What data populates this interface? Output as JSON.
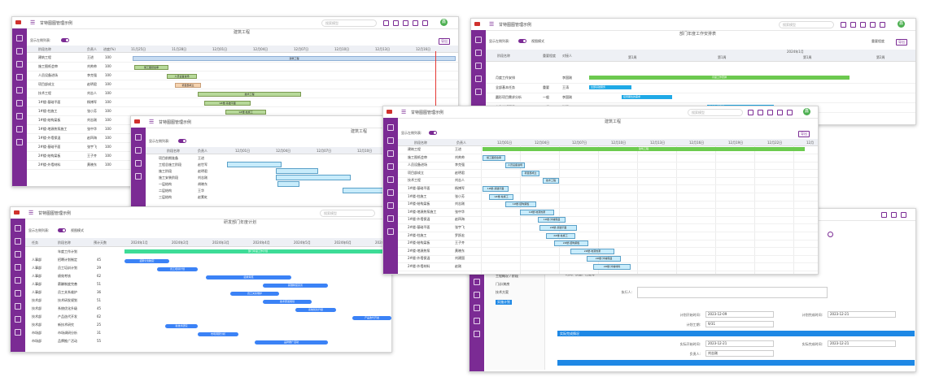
{
  "app": {
    "title": "甘特图图管理示例",
    "search_placeholder": "搜索模型",
    "avatar": "鑫"
  },
  "toggle_label": "显示左侧列表:",
  "view_mode": "视图模式",
  "export": "导出",
  "w1": {
    "tab": "建筑工程",
    "cols": [
      "阶段名称",
      "负责人",
      "进度(%)"
    ],
    "dates": [
      "11月25日",
      "11月28日",
      "12月01日",
      "12月04日",
      "12月07日",
      "12月10日",
      "12月13日",
      "12月16日"
    ],
    "rows": [
      {
        "n": "建筑工程",
        "p": "王进",
        "v": "100"
      },
      {
        "n": "施工图纸会审",
        "p": "刘帅帅",
        "v": "100"
      },
      {
        "n": "人员设备进场",
        "p": "李克强",
        "v": "100"
      },
      {
        "n": "项目部成立",
        "p": "赵明君",
        "v": "100"
      },
      {
        "n": "技术工程",
        "p": "刘志人",
        "v": "100"
      },
      {
        "n": "1#楼-基础平面",
        "p": "杨博军",
        "v": "100"
      },
      {
        "n": "1#楼-柱施工",
        "p": "张小芳",
        "v": "100"
      },
      {
        "n": "1#楼-结构梁板",
        "p": "刘志刚",
        "v": "100"
      },
      {
        "n": "1#楼-地源热泵施工",
        "p": "张中华",
        "v": "100"
      },
      {
        "n": "1#楼-外墙保温",
        "p": "赵四海",
        "v": "100"
      },
      {
        "n": "2#楼-基础平面",
        "p": "张宇飞",
        "v": "100"
      },
      {
        "n": "2#楼-结构梁板",
        "p": "王子齐",
        "v": "100"
      },
      {
        "n": "2#楼-外墙材料",
        "p": "黄晓东",
        "v": "100"
      }
    ],
    "bars": [
      "建筑工程",
      "施工图纸会审",
      "人员设备进场",
      "项目部成立",
      "技术工程",
      "1#楼-基础平面",
      "1#楼-柱施工"
    ]
  },
  "w2": {
    "tab": "部门年度工作安排表",
    "view": "重要程度",
    "cols": [
      "阶段名称",
      "重要程度",
      "对接人"
    ],
    "year": "2024年1月",
    "weeks": [
      "第1周",
      "第1周",
      "第1周",
      "第2周",
      "第3周",
      "第3周",
      "第4周",
      "第5周",
      "第1周",
      "第2周"
    ],
    "rows": [
      {
        "n": "月度工作安排",
        "i": "",
        "p": "李国刚"
      },
      {
        "n": "全部基本任务",
        "i": "重要",
        "p": "王涛"
      },
      {
        "n": "圆形项目需求分析",
        "i": "一般",
        "p": "李国刚"
      },
      {
        "n": "安装编辑项目",
        "i": "一般",
        "p": "张强"
      }
    ],
    "bars": [
      "月度工作安排",
      "全部基础服务",
      "接周期性的需求",
      "全方位 与实施"
    ]
  },
  "w3": {
    "tab": "建筑工程",
    "cols": [
      "阶段名称",
      "负责人"
    ],
    "dates": [
      "12月01日",
      "12月04日",
      "12月07日",
      "12月10日"
    ],
    "rows": [
      {
        "n": "项目前期准备",
        "p": "王进"
      },
      {
        "n": "工程总施工阶段",
        "p": "赵世军"
      },
      {
        "n": "施工阶段",
        "p": "赵明君"
      },
      {
        "n": "施工安装阶段",
        "p": "刘志刚"
      },
      {
        "n": "一层结构",
        "p": "胡晓东"
      },
      {
        "n": "二层结构",
        "p": "王华"
      },
      {
        "n": "三层结构",
        "p": "赵素虹"
      }
    ]
  },
  "w4": {
    "tab": "建筑工程",
    "cols": [
      "阶段名称",
      "负责人"
    ],
    "dates": [
      "12月01日",
      "12月04日",
      "12月07日",
      "12月10日",
      "12月13日",
      "12月16日",
      "12月19日",
      "12月22日",
      "12月"
    ],
    "rows": [
      {
        "n": "建筑工程",
        "p": "王进"
      },
      {
        "n": "施工图纸会审",
        "p": "刘帅帅"
      },
      {
        "n": "人员设备进场",
        "p": "李克强"
      },
      {
        "n": "项目部成立",
        "p": "赵明君"
      },
      {
        "n": "技术工程",
        "p": "刘志人"
      },
      {
        "n": "1#楼-基础平面",
        "p": "杨博军"
      },
      {
        "n": "1#楼-柱施工",
        "p": "张小芳"
      },
      {
        "n": "1#楼-结构梁板",
        "p": "刘志刚"
      },
      {
        "n": "1#楼-地源热泵施工",
        "p": "张中华"
      },
      {
        "n": "1#楼-外墙保温",
        "p": "赵四海"
      },
      {
        "n": "2#楼-基础平面",
        "p": "张宇飞"
      },
      {
        "n": "2#楼-柱施工",
        "p": "罗跃宏"
      },
      {
        "n": "2#楼-结构梁板",
        "p": "王子齐"
      },
      {
        "n": "2#楼-地源热泵",
        "p": "黄晓东"
      },
      {
        "n": "2#楼-外墙保温",
        "p": "刘建国"
      },
      {
        "n": "2#楼-外墙材料",
        "p": "赵刚"
      }
    ],
    "bars": [
      "建筑工程",
      "施工图纸会审",
      "人员设备进场",
      "项目部成立",
      "技术工程",
      "1#楼-基础平面",
      "1#楼-柱施工",
      "1#楼-结构梁板",
      "1#楼-地源热泵",
      "1#楼-外墙保温",
      "2#楼-基础平面",
      "2#楼-柱施工",
      "2#楼-结构梁板",
      "2#楼-地源热泵",
      "2#楼-外墙保温",
      "2#楼-外墙材料"
    ]
  },
  "w5": {
    "tab": "研发部门年度计划",
    "cols": [
      "任务",
      "阶段名称",
      "预计天数"
    ],
    "months": [
      "2024年1月",
      "2024年2月",
      "2024年3月",
      "2024年4月",
      "2024年5月",
      "2024年6月",
      "2024年7月"
    ],
    "summary": "部门年度工作计划",
    "rows": [
      {
        "t": "",
        "n": "年度工作计划",
        "d": ""
      },
      {
        "t": "人事部",
        "n": "招聘计划制定",
        "d": "45"
      },
      {
        "t": "人事部",
        "n": "员工培训计划",
        "d": "29"
      },
      {
        "t": "人事部",
        "n": "绩效考核",
        "d": "62"
      },
      {
        "t": "人事部",
        "n": "薪酬制度完善",
        "d": "51"
      },
      {
        "t": "人事部",
        "n": "员工关系维护",
        "d": "36"
      },
      {
        "t": "技术部",
        "n": "技术研发规划",
        "d": "51"
      },
      {
        "t": "技术部",
        "n": "系统优化升级",
        "d": "45"
      },
      {
        "t": "技术部",
        "n": "产品迭代开发",
        "d": "62"
      },
      {
        "t": "技术部",
        "n": "新技术研究",
        "d": "25"
      },
      {
        "t": "市场部",
        "n": "市场调研分析",
        "d": "31"
      },
      {
        "t": "市场部",
        "n": "品牌推广活动",
        "d": "55"
      }
    ],
    "bars": [
      "招聘计划制定",
      "员工培训计划",
      "绩效考核",
      "薪酬制度完善",
      "员工关系维护",
      "技术研发规划",
      "系统优化升级",
      "产品迭代开发",
      "新技术研究",
      "市场调研分析",
      "品牌推广活动"
    ]
  },
  "w6": {
    "tree": [
      "工程概况 / 阶段",
      "门诊/病房",
      "技术方案",
      "实施计划"
    ],
    "remark": "时间、质量、性能等",
    "fields": {
      "plan_start_label": "计划开始时间:",
      "plan_start": "2023-12-09",
      "plan_end_label": "计划完成时间:",
      "plan_end": "2023-12-21",
      "duration_label": "计划工期:",
      "duration": "9/31",
      "section": "实际完成情况",
      "actual_start_label": "实际开始时间:",
      "actual_start": "2023-12-21",
      "actual_end_label": "实际完成时间:",
      "actual_end": "2023-12-21",
      "assign_label": "负责人:",
      "assign": "刘志刚",
      "owner_label": "执行人:"
    }
  }
}
